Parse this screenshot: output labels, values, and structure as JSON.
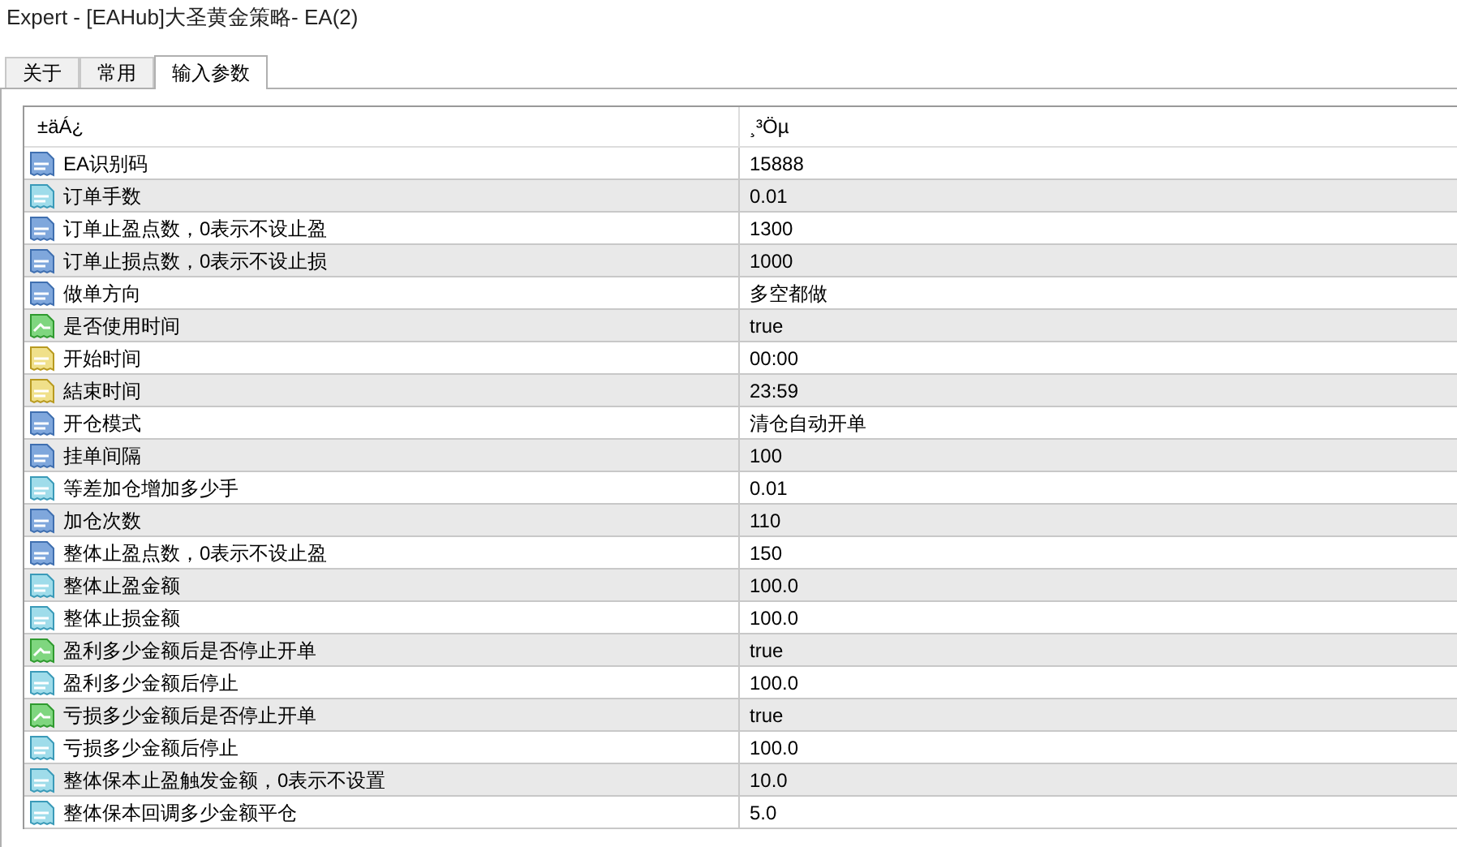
{
  "window": {
    "title": "Expert - [EAHub]大圣黄金策略- EA(2)"
  },
  "tabs": [
    {
      "label": "关于",
      "selected": false
    },
    {
      "label": "常用",
      "selected": false
    },
    {
      "label": "输入参数",
      "selected": true
    }
  ],
  "table": {
    "columns": [
      "±äÁ¿",
      "¸³Öµ"
    ],
    "rows": [
      {
        "kind": "int",
        "name": "EA识别码",
        "value": "15888"
      },
      {
        "kind": "double",
        "name": "订单手数",
        "value": "0.01"
      },
      {
        "kind": "int",
        "name": "订单止盈点数，0表示不设止盈",
        "value": "1300"
      },
      {
        "kind": "int",
        "name": "订单止损点数，0表示不设止损",
        "value": "1000"
      },
      {
        "kind": "int",
        "name": "做单方向",
        "value": "多空都做"
      },
      {
        "kind": "bool",
        "name": "是否使用时间",
        "value": "true"
      },
      {
        "kind": "string",
        "name": "开始时间",
        "value": "00:00"
      },
      {
        "kind": "string",
        "name": "結束时间",
        "value": "23:59"
      },
      {
        "kind": "int",
        "name": "开仓模式",
        "value": "清仓自动开单"
      },
      {
        "kind": "int",
        "name": "挂单间隔",
        "value": "100"
      },
      {
        "kind": "double",
        "name": "等差加仓增加多少手",
        "value": "0.01"
      },
      {
        "kind": "int",
        "name": "加仓次数",
        "value": "110"
      },
      {
        "kind": "int",
        "name": "整体止盈点数，0表示不设止盈",
        "value": "150"
      },
      {
        "kind": "double",
        "name": "整体止盈金额",
        "value": "100.0"
      },
      {
        "kind": "double",
        "name": "整体止损金额",
        "value": "100.0"
      },
      {
        "kind": "bool",
        "name": "盈利多少金额后是否停止开单",
        "value": "true"
      },
      {
        "kind": "double",
        "name": "盈利多少金额后停止",
        "value": "100.0"
      },
      {
        "kind": "bool",
        "name": "亏损多少金额后是否停止开单",
        "value": "true"
      },
      {
        "kind": "double",
        "name": "亏损多少金额后停止",
        "value": "100.0"
      },
      {
        "kind": "double",
        "name": "整体保本止盈触发金额，0表示不设置",
        "value": "10.0"
      },
      {
        "kind": "double",
        "name": "整体保本回调多少金额平仓",
        "value": "5.0"
      }
    ]
  }
}
